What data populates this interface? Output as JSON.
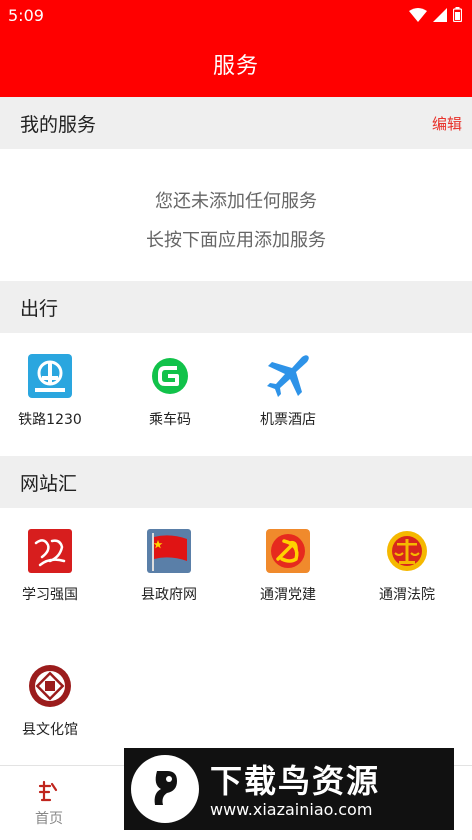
{
  "status_bar": {
    "time": "5:09",
    "icons": [
      "wifi-icon",
      "signal-icon",
      "battery-icon"
    ]
  },
  "header": {
    "title": "服务"
  },
  "my_services": {
    "title": "我的服务",
    "edit_label": "编辑",
    "empty_line1": "您还未添加任何服务",
    "empty_line2": "长按下面应用添加服务"
  },
  "travel": {
    "title": "出行",
    "items": [
      {
        "label": "铁路1230",
        "icon": "railway-icon"
      },
      {
        "label": "乘车码",
        "icon": "ride-code-icon"
      },
      {
        "label": "机票酒店",
        "icon": "airplane-icon"
      }
    ]
  },
  "websites": {
    "title": "网站汇",
    "items": [
      {
        "label": "学习强国",
        "icon": "xuexi-qiangguo-icon"
      },
      {
        "label": "县政府网",
        "icon": "county-government-icon"
      },
      {
        "label": "通渭党建",
        "icon": "party-building-icon"
      },
      {
        "label": "通渭法院",
        "icon": "court-emblem-icon"
      },
      {
        "label": "县文化馆",
        "icon": "culture-center-icon"
      }
    ]
  },
  "bottom_nav": {
    "home_label": "首页",
    "home_icon": "home-logo-icon"
  },
  "watermark": {
    "title": "下载鸟资源",
    "url": "www.xiazainiao.com"
  },
  "colors": {
    "brand_red": "#ff0000",
    "edit_red": "#e8322b",
    "section_gray": "#efefef"
  }
}
